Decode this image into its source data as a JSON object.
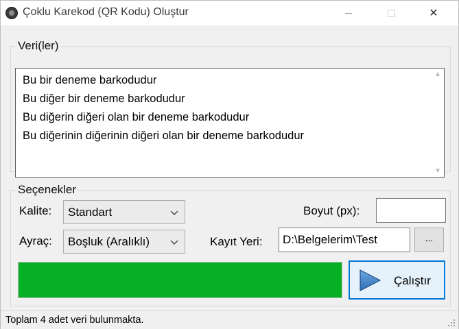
{
  "window": {
    "title": "Çoklu Karekod (QR Kodu) Oluştur",
    "close_glyph": "✕"
  },
  "data_group": {
    "legend": "Veri(ler)",
    "lines": [
      "Bu bir deneme barkodudur",
      "Bu diğer bir deneme barkodudur",
      "Bu diğerin diğeri olan bir deneme barkodudur",
      "Bu diğerinin diğerinin diğeri olan bir deneme barkodudur"
    ]
  },
  "options": {
    "legend": "Seçenekler",
    "quality_label": "Kalite:",
    "quality_value": "Standart",
    "separator_label": "Ayraç:",
    "separator_value": "Boşluk (Aralıklı)",
    "size_label": "Boyut (px):",
    "size_value": "",
    "save_label": "Kayıt Yeri:",
    "save_value": "D:\\Belgelerim\\Test",
    "browse_label": "...",
    "progress_percent": 100,
    "run_label": "Çalıştır"
  },
  "status": {
    "text": "Toplam 4 adet veri bulunmakta."
  },
  "colors": {
    "progress_fill": "#06b025",
    "accent": "#0078d7",
    "play_icon": "#2b6fb8"
  },
  "icons": [
    "app-icon",
    "minimize-icon",
    "maximize-icon",
    "close-icon",
    "chevron-down-icon",
    "play-icon",
    "size-grip-icon"
  ]
}
